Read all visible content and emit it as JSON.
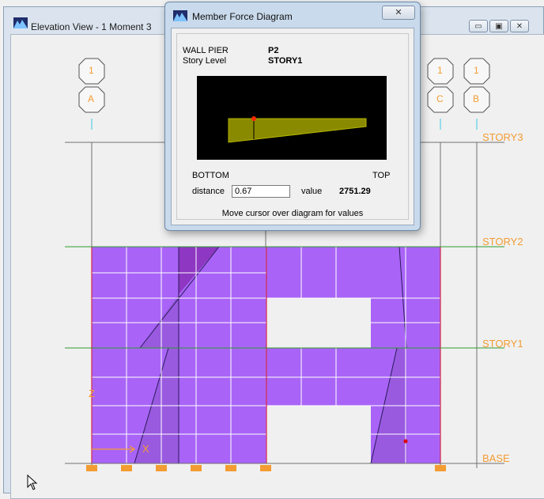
{
  "main_window": {
    "title": "Elevation View - 1   Moment 3",
    "buttons": [
      "▭",
      "▣",
      "✕"
    ]
  },
  "grid_bubbles": [
    {
      "top": "1",
      "bottom": "A"
    },
    {
      "top": "1",
      "bottom": "C"
    },
    {
      "top": "1",
      "bottom": "B"
    }
  ],
  "story_labels": [
    "STORY3",
    "STORY2",
    "STORY1",
    "BASE"
  ],
  "axis_labels": {
    "z": "Z",
    "x": "X"
  },
  "dialog": {
    "title": "Member Force Diagram",
    "close": "✕",
    "wall_pier_label": "WALL PIER",
    "wall_pier_value": "P2",
    "story_level_label": "Story Level",
    "story_level_value": "STORY1",
    "bottom_label": "BOTTOM",
    "top_label": "TOP",
    "distance_label": "distance",
    "distance_value": "0.67",
    "value_label": "value",
    "value_value": "2751.29",
    "hint": "Move cursor over diagram for values"
  },
  "colors": {
    "wall": "#a964f7",
    "wall_grid": "#ffffff",
    "frame_red": "#d62a48",
    "story_line": "#2f9c2f",
    "orange": "#f39c32",
    "diagram_fill": "#8a8a00"
  }
}
